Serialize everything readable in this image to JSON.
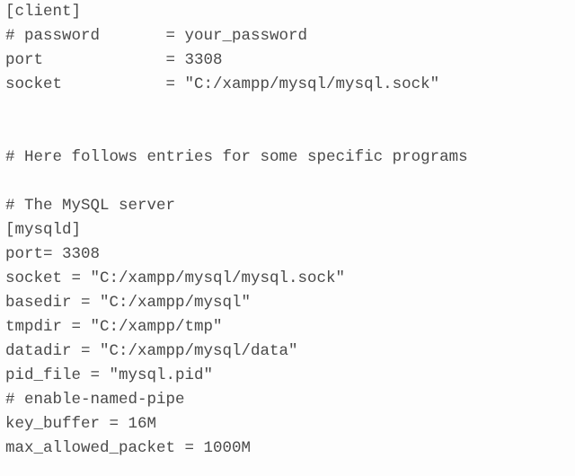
{
  "config": {
    "lines": [
      "[client]",
      "# password       = your_password",
      "port             = 3308",
      "socket           = \"C:/xampp/mysql/mysql.sock\"",
      "",
      "",
      "# Here follows entries for some specific programs",
      "",
      "# The MySQL server",
      "[mysqld]",
      "port= 3308",
      "socket = \"C:/xampp/mysql/mysql.sock\"",
      "basedir = \"C:/xampp/mysql\"",
      "tmpdir = \"C:/xampp/tmp\"",
      "datadir = \"C:/xampp/mysql/data\"",
      "pid_file = \"mysql.pid\"",
      "# enable-named-pipe",
      "key_buffer = 16M",
      "max_allowed_packet = 1000M"
    ]
  }
}
